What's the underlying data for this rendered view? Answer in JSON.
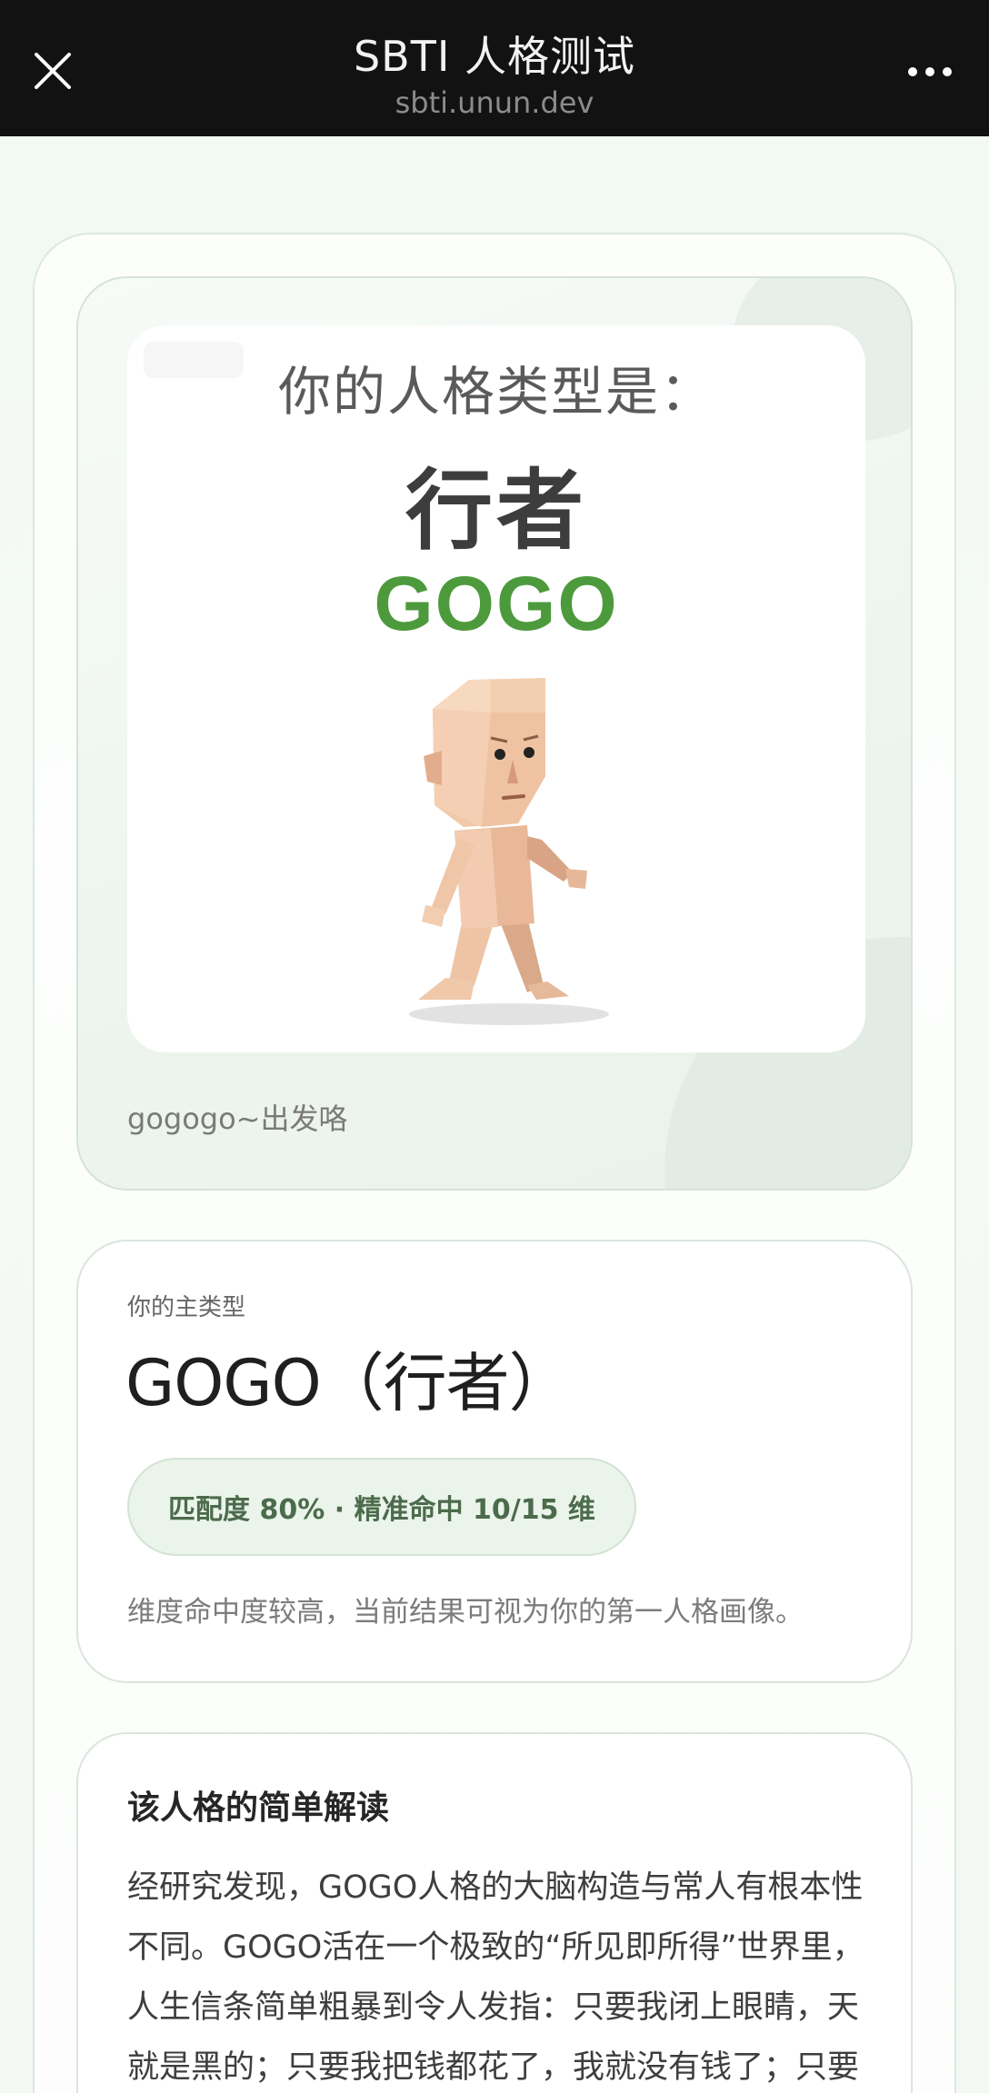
{
  "topbar": {
    "title": "SBTI 人格测试",
    "url": "sbti.unun.dev",
    "close_icon": "close-icon",
    "more_icon": "more-icon"
  },
  "hero": {
    "headline": "你的人格类型是：",
    "name_cn": "行者",
    "code": "GOGO",
    "caption": "gogogo~出发咯",
    "colors": {
      "code": "#4d9a3c",
      "card_bg": "#eef5ef"
    }
  },
  "type_card": {
    "label": "你的主类型",
    "type_name": "GOGO（行者）",
    "badge": "匹配度 80% · 精准命中 10/15 维",
    "description": "维度命中度较高，当前结果可视为你的第一人格画像。"
  },
  "interpretation": {
    "heading": "该人格的简单解读",
    "lines": [
      "经研究发现，GOGO人格的大脑构造与常人有根本性",
      "不同。GOGO活在一个极致的“所见即所得”世界里，",
      "人生信条简单粗暴到令人发指：只要我闭上眼睛，天",
      "就是黑的；只要我把钱都花了，我就没有钱了；只要"
    ]
  }
}
